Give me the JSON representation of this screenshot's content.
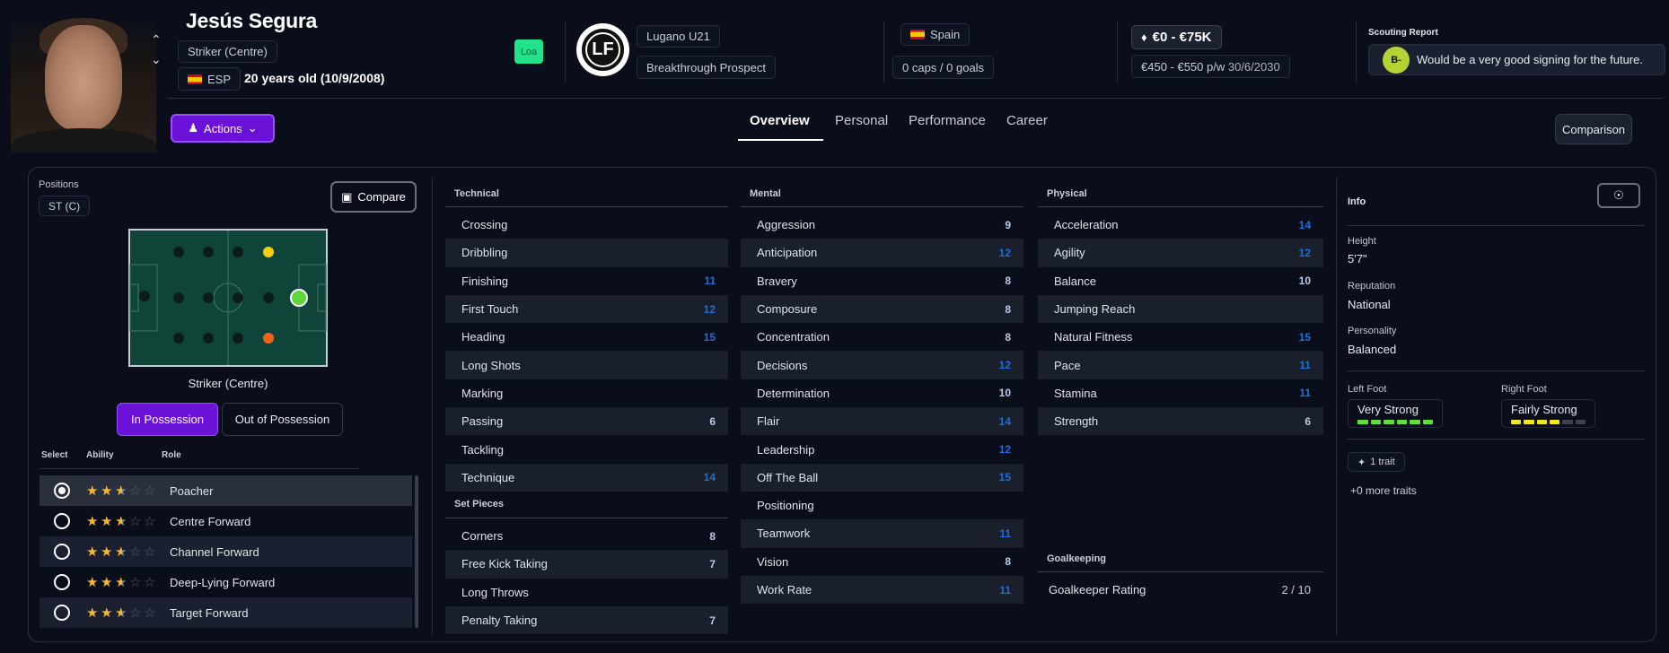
{
  "player": {
    "name": "Jesús Segura",
    "position": "Striker (Centre)",
    "nationality_code": "ESP",
    "age_text": "20 years old (10/9/2008)",
    "loan_badge": "Loa"
  },
  "club": {
    "name": "Lugano U21",
    "status": "Breakthrough Prospect",
    "logo_text": "LF"
  },
  "nation": {
    "name": "Spain",
    "caps": "0 caps / 0 goals"
  },
  "value": {
    "range": "€0 - €75K",
    "wage": "€450 - €550 p/w",
    "contract_end": "30/6/2030"
  },
  "scouting": {
    "label": "Scouting Report",
    "grade": "B-",
    "text": "Would be a very good signing for the future."
  },
  "actions_label": "Actions",
  "tabs": [
    "Overview",
    "Personal",
    "Performance",
    "Career"
  ],
  "comparison_label": "Comparison",
  "positions": {
    "label": "Positions",
    "chip": "ST (C)",
    "compare_label": "Compare",
    "selected_position": "Striker (Centre)",
    "in_possession": "In Possession",
    "out_of_possession": "Out of Possession"
  },
  "roles_header": {
    "select": "Select",
    "ability": "Ability",
    "role": "Role"
  },
  "roles": [
    {
      "name": "Poacher",
      "stars": 2.5,
      "selected": true
    },
    {
      "name": "Centre Forward",
      "stars": 2.5,
      "selected": false
    },
    {
      "name": "Channel Forward",
      "stars": 2.5,
      "selected": false
    },
    {
      "name": "Deep-Lying Forward",
      "stars": 2.5,
      "selected": false
    },
    {
      "name": "Target Forward",
      "stars": 2.5,
      "selected": false
    }
  ],
  "technical": {
    "title": "Technical",
    "items": [
      [
        "Crossing",
        ""
      ],
      [
        "Dribbling",
        ""
      ],
      [
        "Finishing",
        "11"
      ],
      [
        "First Touch",
        "12"
      ],
      [
        "Heading",
        "15"
      ],
      [
        "Long Shots",
        ""
      ],
      [
        "Marking",
        ""
      ],
      [
        "Passing",
        "6"
      ],
      [
        "Tackling",
        ""
      ],
      [
        "Technique",
        "14"
      ]
    ]
  },
  "set_pieces": {
    "title": "Set Pieces",
    "items": [
      [
        "Corners",
        "8"
      ],
      [
        "Free Kick Taking",
        "7"
      ],
      [
        "Long Throws",
        ""
      ],
      [
        "Penalty Taking",
        "7"
      ]
    ]
  },
  "mental": {
    "title": "Mental",
    "items": [
      [
        "Aggression",
        "9"
      ],
      [
        "Anticipation",
        "12"
      ],
      [
        "Bravery",
        "8"
      ],
      [
        "Composure",
        "8"
      ],
      [
        "Concentration",
        "8"
      ],
      [
        "Decisions",
        "12"
      ],
      [
        "Determination",
        "10"
      ],
      [
        "Flair",
        "14"
      ],
      [
        "Leadership",
        "12"
      ],
      [
        "Off The Ball",
        "15"
      ],
      [
        "Positioning",
        ""
      ],
      [
        "Teamwork",
        "11"
      ],
      [
        "Vision",
        "8"
      ],
      [
        "Work Rate",
        "11"
      ]
    ]
  },
  "physical": {
    "title": "Physical",
    "items": [
      [
        "Acceleration",
        "14"
      ],
      [
        "Agility",
        "12"
      ],
      [
        "Balance",
        "10"
      ],
      [
        "Jumping Reach",
        ""
      ],
      [
        "Natural Fitness",
        "15"
      ],
      [
        "Pace",
        "11"
      ],
      [
        "Stamina",
        "11"
      ],
      [
        "Strength",
        "6"
      ]
    ]
  },
  "goalkeeping": {
    "title": "Goalkeeping",
    "rating_label": "Goalkeeper Rating",
    "rating": "2 / 10"
  },
  "info": {
    "title": "Info",
    "height_label": "Height",
    "height": "5'7\"",
    "reputation_label": "Reputation",
    "reputation": "National",
    "personality_label": "Personality",
    "personality": "Balanced",
    "left_foot_label": "Left Foot",
    "left_foot": "Very Strong",
    "left_foot_level": 6,
    "right_foot_label": "Right Foot",
    "right_foot": "Fairly Strong",
    "right_foot_level": 4,
    "traits": "1 trait",
    "more_traits": "+0 more traits"
  },
  "colors": {
    "accent": "#6a12d8",
    "loan": "#22e38a",
    "grade": "#b5d334",
    "high_attr": "#1e6fd9",
    "left_foot": "#5fe03a",
    "right_foot": "#f0ea1a"
  }
}
